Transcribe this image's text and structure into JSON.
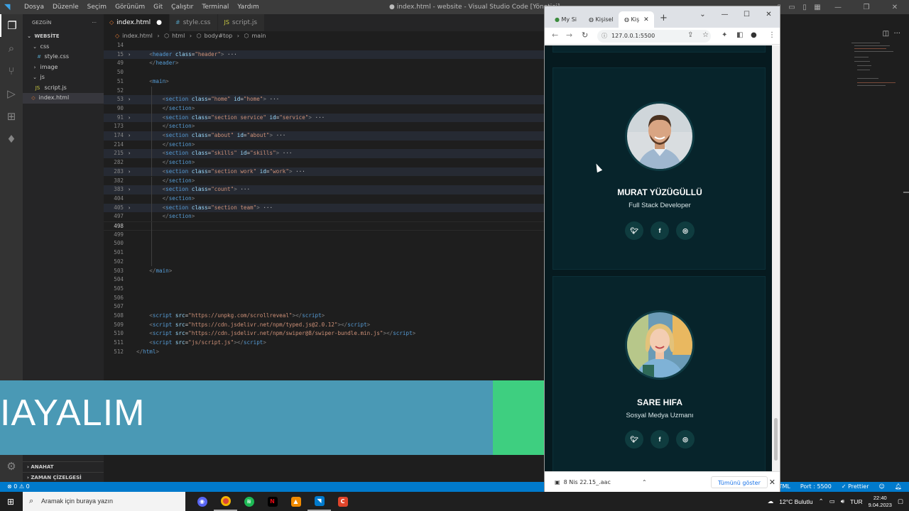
{
  "vscode": {
    "menu": [
      "Dosya",
      "Düzenle",
      "Seçim",
      "Görünüm",
      "Git",
      "Çalıştır",
      "Terminal",
      "Yardım"
    ],
    "window_title": "● index.html - website - Visual Studio Code [Yönetici]",
    "sidebar": {
      "header": "GEZGİN",
      "root": "WEBSİTE",
      "tree": [
        {
          "label": "css",
          "kind": "folder",
          "indent": 1
        },
        {
          "label": "style.css",
          "kind": "css",
          "indent": 2
        },
        {
          "label": "image",
          "kind": "folder",
          "indent": 1
        },
        {
          "label": "js",
          "kind": "folder",
          "indent": 1
        },
        {
          "label": "script.js",
          "kind": "js",
          "indent": 2
        },
        {
          "label": "index.html",
          "kind": "html",
          "indent": 1,
          "selected": true
        }
      ],
      "outline": "ANAHAT",
      "timeline": "ZAMAN ÇİZELGESİ"
    },
    "tabs": [
      {
        "label": "index.html",
        "icon": "<>",
        "active": true,
        "dirty": true
      },
      {
        "label": "style.css",
        "icon": "#",
        "active": false
      },
      {
        "label": "script.js",
        "icon": "JS",
        "active": false
      }
    ],
    "breadcrumb": [
      "index.html",
      "html",
      "body#top",
      "main"
    ],
    "code_lines": [
      {
        "n": "14",
        "code": []
      },
      {
        "n": "15",
        "fold": true,
        "hl": true,
        "code": [
          [
            "tg",
            "    <"
          ],
          [
            "tn",
            "header"
          ],
          [
            "at",
            " class"
          ],
          [
            "tx",
            "="
          ],
          [
            "st",
            "\"header\""
          ],
          [
            "tg",
            ">"
          ],
          [
            "el",
            " ···"
          ]
        ]
      },
      {
        "n": "49",
        "code": [
          [
            "tg",
            "    </"
          ],
          [
            "tn",
            "header"
          ],
          [
            "tg",
            ">"
          ]
        ]
      },
      {
        "n": "50",
        "code": []
      },
      {
        "n": "51",
        "code": [
          [
            "tg",
            "    <"
          ],
          [
            "tn",
            "main"
          ],
          [
            "tg",
            ">"
          ]
        ]
      },
      {
        "n": "52",
        "code": []
      },
      {
        "n": "53",
        "fold": true,
        "hl": true,
        "code": [
          [
            "tg",
            "        <"
          ],
          [
            "tn",
            "section"
          ],
          [
            "at",
            " class"
          ],
          [
            "tx",
            "="
          ],
          [
            "st",
            "\"home\""
          ],
          [
            "at",
            " id"
          ],
          [
            "tx",
            "="
          ],
          [
            "st",
            "\"home\""
          ],
          [
            "tg",
            ">"
          ],
          [
            "el",
            " ···"
          ]
        ]
      },
      {
        "n": "90",
        "code": [
          [
            "tg",
            "        </"
          ],
          [
            "tn",
            "section"
          ],
          [
            "tg",
            ">"
          ]
        ]
      },
      {
        "n": "91",
        "fold": true,
        "hl": true,
        "code": [
          [
            "tg",
            "        <"
          ],
          [
            "tn",
            "section"
          ],
          [
            "at",
            " class"
          ],
          [
            "tx",
            "="
          ],
          [
            "st",
            "\"section service\""
          ],
          [
            "at",
            " id"
          ],
          [
            "tx",
            "="
          ],
          [
            "st",
            "\"service\""
          ],
          [
            "tg",
            ">"
          ],
          [
            "el",
            " ···"
          ]
        ]
      },
      {
        "n": "173",
        "code": [
          [
            "tg",
            "        </"
          ],
          [
            "tn",
            "section"
          ],
          [
            "tg",
            ">"
          ]
        ]
      },
      {
        "n": "174",
        "fold": true,
        "hl": true,
        "code": [
          [
            "tg",
            "        <"
          ],
          [
            "tn",
            "section"
          ],
          [
            "at",
            " class"
          ],
          [
            "tx",
            "="
          ],
          [
            "st",
            "\"about\""
          ],
          [
            "at",
            " id"
          ],
          [
            "tx",
            "="
          ],
          [
            "st",
            "\"about\""
          ],
          [
            "tg",
            ">"
          ],
          [
            "el",
            " ···"
          ]
        ]
      },
      {
        "n": "214",
        "code": [
          [
            "tg",
            "        </"
          ],
          [
            "tn",
            "section"
          ],
          [
            "tg",
            ">"
          ]
        ]
      },
      {
        "n": "215",
        "fold": true,
        "hl": true,
        "code": [
          [
            "tg",
            "        <"
          ],
          [
            "tn",
            "section"
          ],
          [
            "at",
            " class"
          ],
          [
            "tx",
            "="
          ],
          [
            "st",
            "\"skills\""
          ],
          [
            "at",
            " id"
          ],
          [
            "tx",
            "="
          ],
          [
            "st",
            "\"skills\""
          ],
          [
            "tg",
            ">"
          ],
          [
            "el",
            " ···"
          ]
        ]
      },
      {
        "n": "282",
        "code": [
          [
            "tg",
            "        </"
          ],
          [
            "tn",
            "section"
          ],
          [
            "tg",
            ">"
          ]
        ]
      },
      {
        "n": "283",
        "fold": true,
        "hl": true,
        "code": [
          [
            "tg",
            "        <"
          ],
          [
            "tn",
            "section"
          ],
          [
            "at",
            " class"
          ],
          [
            "tx",
            "="
          ],
          [
            "st",
            "\"section work\""
          ],
          [
            "at",
            " id"
          ],
          [
            "tx",
            "="
          ],
          [
            "st",
            "\"work\""
          ],
          [
            "tg",
            ">"
          ],
          [
            "el",
            " ···"
          ]
        ]
      },
      {
        "n": "382",
        "code": [
          [
            "tg",
            "        </"
          ],
          [
            "tn",
            "section"
          ],
          [
            "tg",
            ">"
          ]
        ]
      },
      {
        "n": "383",
        "fold": true,
        "hl": true,
        "code": [
          [
            "tg",
            "        <"
          ],
          [
            "tn",
            "section"
          ],
          [
            "at",
            " class"
          ],
          [
            "tx",
            "="
          ],
          [
            "st",
            "\"count\""
          ],
          [
            "tg",
            ">"
          ],
          [
            "el",
            " ···"
          ]
        ]
      },
      {
        "n": "404",
        "code": [
          [
            "tg",
            "        </"
          ],
          [
            "tn",
            "section"
          ],
          [
            "tg",
            ">"
          ]
        ]
      },
      {
        "n": "405",
        "fold": true,
        "hl": true,
        "code": [
          [
            "tg",
            "        <"
          ],
          [
            "tn",
            "section"
          ],
          [
            "at",
            " class"
          ],
          [
            "tx",
            "="
          ],
          [
            "st",
            "\"section team\""
          ],
          [
            "tg",
            ">"
          ],
          [
            "el",
            " ···"
          ]
        ]
      },
      {
        "n": "497",
        "code": [
          [
            "tg",
            "        </"
          ],
          [
            "tn",
            "section"
          ],
          [
            "tg",
            ">"
          ]
        ]
      },
      {
        "n": "498",
        "cur": true,
        "code": []
      },
      {
        "n": "499",
        "code": []
      },
      {
        "n": "500",
        "code": []
      },
      {
        "n": "501",
        "code": []
      },
      {
        "n": "502",
        "code": []
      },
      {
        "n": "503",
        "code": [
          [
            "tg",
            "    </"
          ],
          [
            "tn",
            "main"
          ],
          [
            "tg",
            ">"
          ]
        ]
      },
      {
        "n": "504",
        "code": []
      },
      {
        "n": "505",
        "code": []
      },
      {
        "n": "506",
        "code": []
      },
      {
        "n": "507",
        "code": []
      },
      {
        "n": "508",
        "code": [
          [
            "tg",
            "    <"
          ],
          [
            "tn",
            "script"
          ],
          [
            "at",
            " src"
          ],
          [
            "tx",
            "="
          ],
          [
            "st",
            "\"https://unpkg.com/scrollreveal\""
          ],
          [
            "tg",
            ">"
          ],
          [
            "tg",
            "</"
          ],
          [
            "tn",
            "script"
          ],
          [
            "tg",
            ">"
          ]
        ]
      },
      {
        "n": "509",
        "code": [
          [
            "tg",
            "    <"
          ],
          [
            "tn",
            "script"
          ],
          [
            "at",
            " src"
          ],
          [
            "tx",
            "="
          ],
          [
            "st",
            "\"https://cdn.jsdelivr.net/npm/typed.js@2.0.12\""
          ],
          [
            "tg",
            ">"
          ],
          [
            "tg",
            "</"
          ],
          [
            "tn",
            "script"
          ],
          [
            "tg",
            ">"
          ]
        ]
      },
      {
        "n": "510",
        "code": [
          [
            "tg",
            "    <"
          ],
          [
            "tn",
            "script"
          ],
          [
            "at",
            " src"
          ],
          [
            "tx",
            "="
          ],
          [
            "st",
            "\"https://cdn.jsdelivr.net/npm/swiper@8/swiper-bundle.min.js\""
          ],
          [
            "tg",
            ">"
          ],
          [
            "tg",
            "</"
          ],
          [
            "tn",
            "script"
          ],
          [
            "tg",
            ">"
          ]
        ]
      },
      {
        "n": "511",
        "code": [
          [
            "tg",
            "    <"
          ],
          [
            "tn",
            "script"
          ],
          [
            "at",
            " src"
          ],
          [
            "tx",
            "="
          ],
          [
            "st",
            "\"js/script.js\""
          ],
          [
            "tg",
            ">"
          ],
          [
            "tg",
            "</"
          ],
          [
            "tn",
            "script"
          ],
          [
            "tg",
            ">"
          ]
        ]
      },
      {
        "n": "512",
        "code": [
          [
            "tg",
            "</"
          ],
          [
            "tn",
            "html"
          ],
          [
            "tg",
            ">"
          ]
        ]
      }
    ],
    "status_left": "⊗ 0 ⚠ 0",
    "status_right": [
      "HTML",
      "Port : 5500",
      "✓ Prettier"
    ]
  },
  "banner": {
    "text": "IAYALIM",
    "blue_color": "#4a99b5",
    "green_color": "#3ecf80"
  },
  "browser": {
    "tabs": [
      {
        "label": "My Si",
        "active": false
      },
      {
        "label": "Kişisel",
        "active": false
      },
      {
        "label": "Kiş",
        "active": true
      }
    ],
    "url": "127.0.0.1:5500",
    "team": [
      {
        "name": "MURAT YÜZÜGÜLLÜ",
        "role": "Full Stack Developer",
        "socials": [
          "twitter-icon",
          "facebook-icon",
          "instagram-icon"
        ]
      },
      {
        "name": "SARE HIFA",
        "role": "Sosyal Medya Uzmanı",
        "socials": [
          "twitter-icon",
          "facebook-icon",
          "instagram-icon"
        ]
      }
    ],
    "download": {
      "file": "8 Nis 22.15_.aac",
      "show_all": "Tümünü göster"
    }
  },
  "taskbar": {
    "search_placeholder": "Aramak için buraya yazın",
    "weather": "12°C Bulutlu",
    "lang": "TUR",
    "time": "22:40",
    "date": "9.04.2023"
  }
}
